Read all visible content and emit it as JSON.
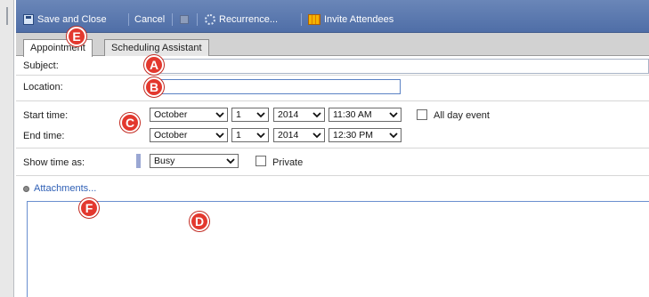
{
  "toolbar": {
    "save_close": "Save and Close",
    "cancel": "Cancel",
    "recurrence": "Recurrence...",
    "invite": "Invite Attendees"
  },
  "tabs": [
    "Appointment",
    "Scheduling Assistant"
  ],
  "form": {
    "subject_label": "Subject:",
    "location_label": "Location:",
    "start_label": "Start time:",
    "end_label": "End time:",
    "start": {
      "month": "October",
      "day": "1",
      "year": "2014",
      "time": "11:30 AM"
    },
    "end": {
      "month": "October",
      "day": "1",
      "year": "2014",
      "time": "12:30 PM"
    },
    "all_day_label": "All day event",
    "show_time_label": "Show time as:",
    "show_time_value": "Busy",
    "private_label": "Private",
    "attachments": "Attachments..."
  },
  "markers": {
    "a": "A",
    "b": "B",
    "c": "C",
    "d": "D",
    "e": "E",
    "f": "F"
  },
  "colors": {
    "toolbar": "#5b78ae",
    "marker": "#e3382e",
    "link": "#2e5fb5"
  }
}
